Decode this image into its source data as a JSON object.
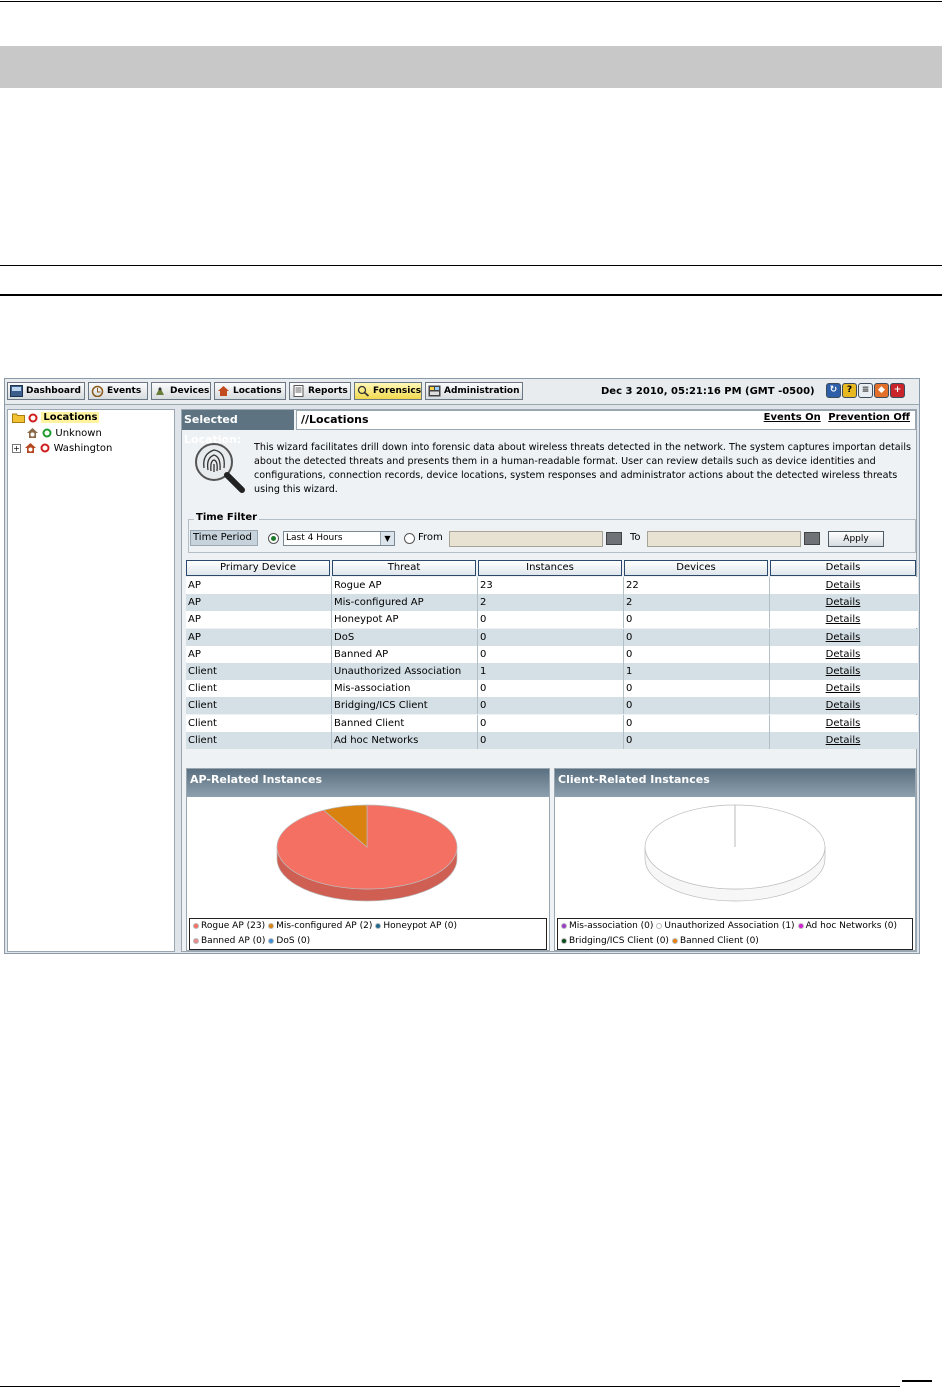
{
  "tabs": [
    {
      "label": "Dashboard",
      "icon": "dashboard-icon",
      "active": false
    },
    {
      "label": "Events",
      "icon": "events-icon",
      "active": false
    },
    {
      "label": "Devices",
      "icon": "devices-icon",
      "active": false
    },
    {
      "label": "Locations",
      "icon": "locations-icon",
      "active": false
    },
    {
      "label": "Reports",
      "icon": "reports-icon",
      "active": false
    },
    {
      "label": "Forensics",
      "icon": "forensics-icon",
      "active": true
    },
    {
      "label": "Administration",
      "icon": "administration-icon",
      "active": false
    }
  ],
  "header": {
    "datetime": "Dec 3 2010, 05:21:16 PM (GMT -0500)",
    "toolbar_icons": [
      "refresh-icon",
      "help-icon",
      "list-icon",
      "shield-icon",
      "exit-icon"
    ]
  },
  "tree": {
    "root": "Locations",
    "children": [
      "Unknown",
      "Washington"
    ]
  },
  "location": {
    "label": "Selected Location:",
    "value": "//Locations",
    "events": "Events On",
    "prevention": "Prevention Off"
  },
  "wizard": {
    "text": "This wizard facilitates drill down into forensic data about wireless threats detected in the network. The system captures importan details about the detected threats and presents them in a human-readable format. User can review details such as device identities and configurations, connection records, device locations, system responses and administrator actions about the detected wireless threats using this wizard."
  },
  "time_filter": {
    "title": "Time Filter",
    "period_label": "Time Period",
    "period_value": "Last 4 Hours",
    "from_label": "From",
    "to_label": "To",
    "apply_label": "Apply"
  },
  "table": {
    "headers": [
      "Primary Device",
      "Threat",
      "Instances",
      "Devices",
      "Details"
    ],
    "rows": [
      [
        "AP",
        "Rogue AP",
        "23",
        "22",
        "Details"
      ],
      [
        "AP",
        "Mis-configured AP",
        "2",
        "2",
        "Details"
      ],
      [
        "AP",
        "Honeypot AP",
        "0",
        "0",
        "Details"
      ],
      [
        "AP",
        "DoS",
        "0",
        "0",
        "Details"
      ],
      [
        "AP",
        "Banned AP",
        "0",
        "0",
        "Details"
      ],
      [
        "Client",
        "Unauthorized Association",
        "1",
        "1",
        "Details"
      ],
      [
        "Client",
        "Mis-association",
        "0",
        "0",
        "Details"
      ],
      [
        "Client",
        "Bridging/ICS Client",
        "0",
        "0",
        "Details"
      ],
      [
        "Client",
        "Banned Client",
        "0",
        "0",
        "Details"
      ],
      [
        "Client",
        "Ad hoc Networks",
        "0",
        "0",
        "Details"
      ]
    ]
  },
  "charts": {
    "ap": {
      "title": "AP-Related Instances",
      "legend": [
        {
          "label": "Rogue AP (23)",
          "color": "#f47062"
        },
        {
          "label": "Mis-configured AP (2)",
          "color": "#d9820f"
        },
        {
          "label": "Honeypot AP (0)",
          "color": "#1f6a8f"
        },
        {
          "label": "Banned AP (0)",
          "color": "#e78a8a"
        },
        {
          "label": "DoS (0)",
          "color": "#3d8fd6"
        }
      ],
      "slices": [
        {
          "value": 23,
          "color": "#f47062"
        },
        {
          "value": 2,
          "color": "#d9820f"
        }
      ]
    },
    "client": {
      "title": "Client-Related Instances",
      "legend": [
        {
          "label": "Mis-association (0)",
          "color": "#9b3fc9"
        },
        {
          "label": "Unauthorized Association (1)",
          "color": "#ffffff"
        },
        {
          "label": "Ad hoc Networks (0)",
          "color": "#d21fd2"
        },
        {
          "label": "Bridging/ICS Client (0)",
          "color": "#0d4d1e"
        },
        {
          "label": "Banned Client (0)",
          "color": "#e8820c"
        }
      ],
      "slices": [
        {
          "value": 1,
          "color": "#ffffff"
        }
      ]
    }
  }
}
